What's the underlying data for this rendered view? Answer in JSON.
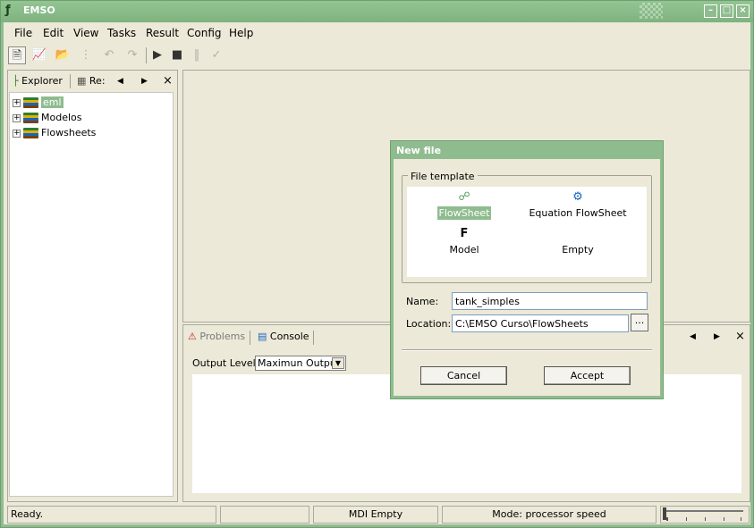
{
  "window": {
    "title": "EMSO"
  },
  "menu": [
    "File",
    "Edit",
    "View",
    "Tasks",
    "Result",
    "Config",
    "Help"
  ],
  "explorer": {
    "tabs": [
      "Explorer",
      "Re:"
    ],
    "tree": [
      {
        "label": "eml",
        "selected": true
      },
      {
        "label": "Modelos",
        "selected": false
      },
      {
        "label": "Flowsheets",
        "selected": false
      }
    ]
  },
  "bottom_panel": {
    "tabs": [
      "Problems",
      "Console"
    ],
    "active_tab": "Console",
    "output_level_label": "Output Level:",
    "output_level_value": "Maximun Output"
  },
  "status_bar": {
    "ready": "Ready.",
    "mdi": "MDI Empty",
    "mode": "Mode: processor speed"
  },
  "dialog": {
    "title": "New file",
    "group_label": "File template",
    "templates": [
      {
        "label": "FlowSheet",
        "selected": true,
        "icon": "flowsheet-icon"
      },
      {
        "label": "Equation FlowSheet",
        "selected": false,
        "icon": "equation-flowsheet-icon"
      },
      {
        "label": "Model",
        "selected": false,
        "icon": "model-icon"
      },
      {
        "label": "Empty",
        "selected": false,
        "icon": ""
      }
    ],
    "name_label": "Name:",
    "name_value": "tank_simples",
    "location_label": "Location:",
    "location_value": "C:\\EMSO Curso\\FlowSheets",
    "browse_label": "...",
    "cancel_label": "Cancel",
    "accept_label": "Accept"
  },
  "colors": {
    "accent": "#8fbc8f",
    "face": "#ece9d8"
  }
}
